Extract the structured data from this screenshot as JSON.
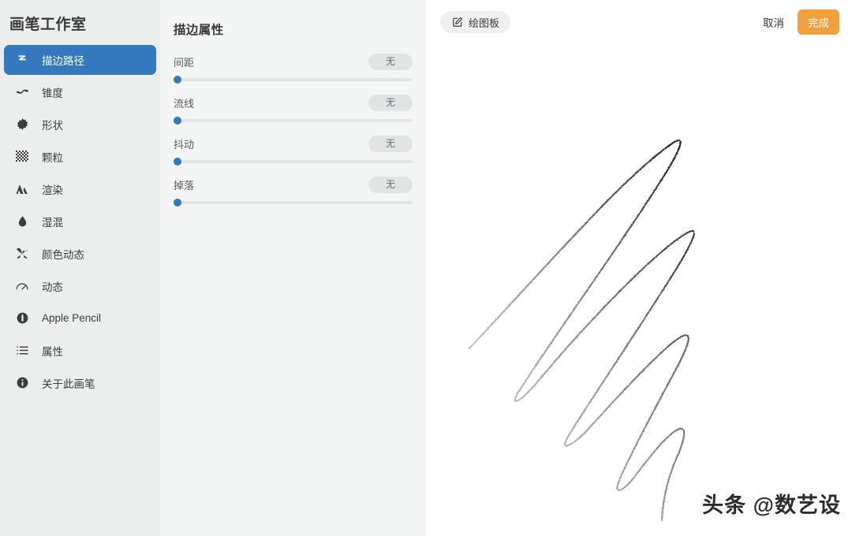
{
  "sidebar": {
    "title": "画笔工作室",
    "items": [
      {
        "label": "描边路径",
        "icon": "stroke-path-icon",
        "active": true
      },
      {
        "label": "锥度",
        "icon": "taper-wave-icon",
        "active": false
      },
      {
        "label": "形状",
        "icon": "shape-star-icon",
        "active": false
      },
      {
        "label": "颗粒",
        "icon": "grain-grid-icon",
        "active": false
      },
      {
        "label": "渲染",
        "icon": "render-triangles-icon",
        "active": false
      },
      {
        "label": "湿混",
        "icon": "wet-mix-droplet-icon",
        "active": false
      },
      {
        "label": "颜色动态",
        "icon": "color-dynamics-pinwheel-icon",
        "active": false
      },
      {
        "label": "动态",
        "icon": "dynamics-gauge-icon",
        "active": false
      },
      {
        "label": "Apple Pencil",
        "icon": "apple-pencil-icon",
        "active": false
      },
      {
        "label": "属性",
        "icon": "attributes-list-icon",
        "active": false
      },
      {
        "label": "关于此画笔",
        "icon": "about-info-icon",
        "active": false
      }
    ]
  },
  "properties_panel": {
    "title": "描边属性",
    "sliders": [
      {
        "label": "间距",
        "value": "无",
        "position_pct": 0
      },
      {
        "label": "流线",
        "value": "无",
        "position_pct": 0
      },
      {
        "label": "抖动",
        "value": "无",
        "position_pct": 0
      },
      {
        "label": "掉落",
        "value": "无",
        "position_pct": 0
      }
    ]
  },
  "canvas": {
    "draw_board_button": "绘图板",
    "draw_board_icon": "edit-square-icon",
    "cancel_button": "取消",
    "done_button": "完成",
    "watermark": "头条 @数艺设"
  },
  "colors": {
    "accent_blue": "#3478BE",
    "done_orange": "#F2A03D",
    "sidebar_bg": "#ECEDED",
    "panel_bg": "#F4F5F5",
    "canvas_bg": "#FFFFFF"
  }
}
